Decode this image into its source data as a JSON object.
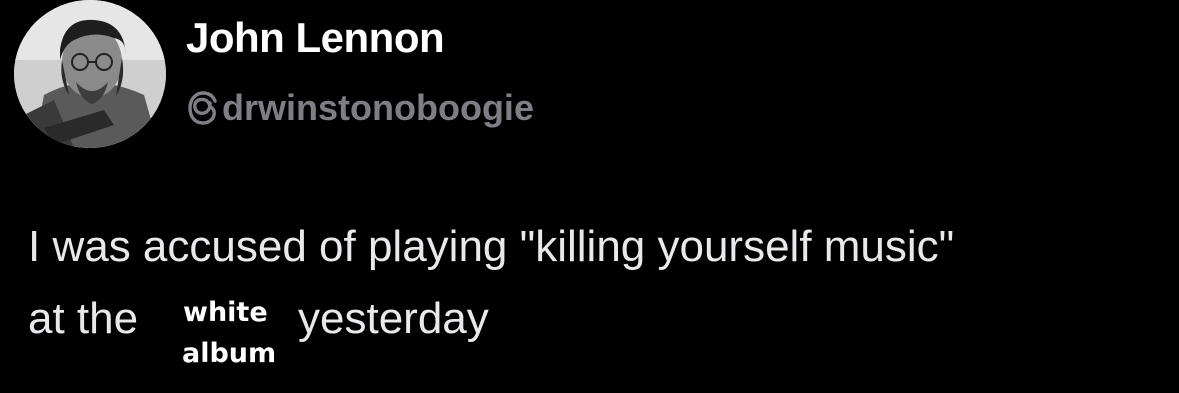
{
  "author": {
    "display_name": "John Lennon",
    "handle": "drwinstonoboogie",
    "avatar_icon": "profile-photo",
    "handle_icon": "threads-icon"
  },
  "post": {
    "line1": "I was accused of playing \"killing yourself music\"",
    "line2_start": "at the",
    "overlay_word_1": "white",
    "overlay_word_2": "album",
    "line2_end": "yesterday"
  },
  "colors": {
    "background": "#000000",
    "name": "#ffffff",
    "handle": "#7d7f84",
    "body": "#e7e9ea"
  }
}
